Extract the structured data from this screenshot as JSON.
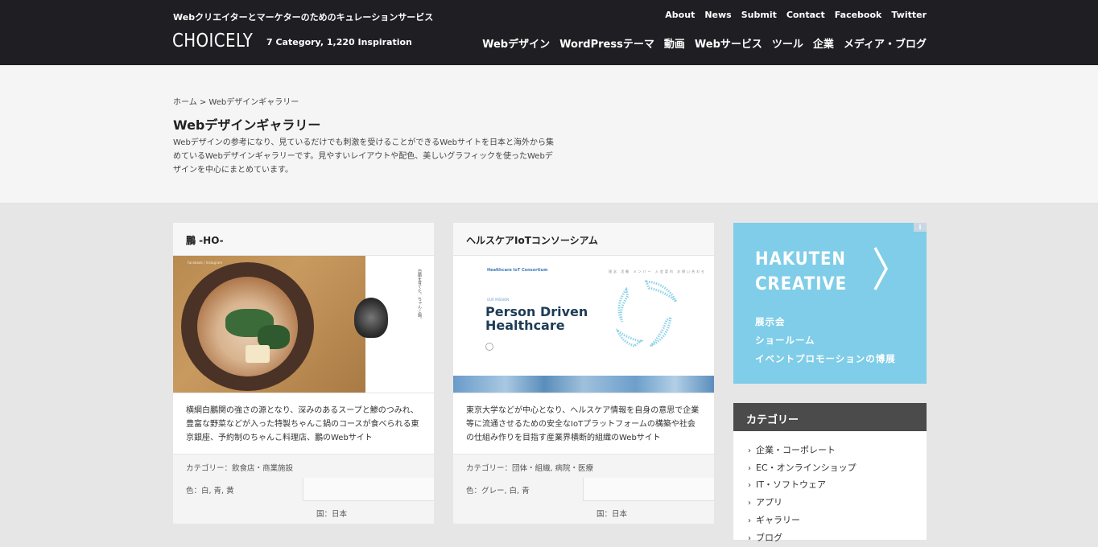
{
  "header": {
    "tagline": "Webクリエイターとマーケターのためのキュレーションサービス",
    "logo": "CHOICELY",
    "stats": "7 Category, 1,220 Inspiration",
    "toplinks": [
      "About",
      "News",
      "Submit",
      "Contact",
      "Facebook",
      "Twitter"
    ],
    "nav": [
      "Webデザイン",
      "WordPressテーマ",
      "動画",
      "Webサービス",
      "ツール",
      "企業",
      "メディア・ブログ"
    ]
  },
  "intro": {
    "breadcrumb": "ホーム > Webデザインギャラリー",
    "title": "Webデザインギャラリー",
    "description": "Webデザインの参考になり、見ているだけでも刺激を受けることができるWebサイトを日本と海外から集めているWebデザインギャラリーです。見やすいレイアウトや配色、美しいグラフィックを使ったWebデザインを中心にまとめています。"
  },
  "cards": [
    {
      "title": "鵬 -HO-",
      "description": "横綱白鵬関の強さの源となり、深みのあるスープと鯵のつみれ、豊富な野菜などが入った特製ちゃんこ鍋のコースが食べられる東京銀座、予約制のちゃんこ料理店、鵬のWebサイト",
      "category": "カテゴリー：飲食店・商業施設",
      "colors": "色：白, 青, 黄",
      "country": "国：日本",
      "img_small": "Facebook / Instagram",
      "img_vtext": "白鵬を育てた、ちゃんこ鍋。"
    },
    {
      "title": "ヘルスケアIoTコンソーシアム",
      "description": "東京大学などが中心となり、ヘルスケア情報を自身の意思で企業等に流通させるための安全なIoTプラットフォームの構築や社会の仕組み作りを目指す産業界横断的組織のWebサイト",
      "category": "カテゴリー：団体・組織, 病院・医療",
      "colors": "色：グレー, 白, 青",
      "country": "国：日本",
      "img_logo": "Healthcare IoT Consortium",
      "img_nav": "理念 活動 メンバー 入会案内 お問い合わせ",
      "img_small": "OUR MISSION",
      "img_h1": "Person Driven\nHealthcare"
    }
  ],
  "ad": {
    "info": "i",
    "title": "HAKUTEN\nCREATIVE",
    "lines": [
      "展示会",
      "ショールーム",
      "イベントプロモーションの博展"
    ],
    "color": "#7fcde8"
  },
  "categories": {
    "heading": "カテゴリー",
    "items": [
      "企業・コーポレート",
      "EC・オンラインショップ",
      "IT・ソフトウェア",
      "アプリ",
      "ギャラリー",
      "ブログ"
    ]
  }
}
